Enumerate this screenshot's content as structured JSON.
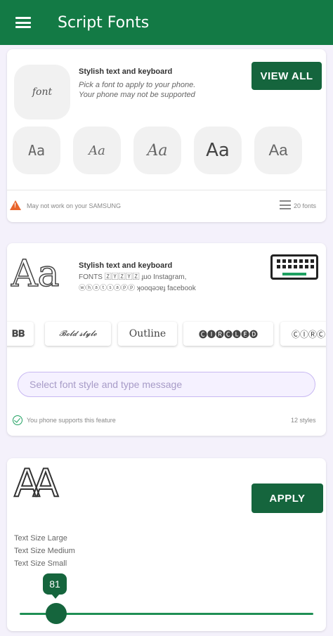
{
  "app": {
    "title": "Script Fonts"
  },
  "colors": {
    "primary": "#137a45",
    "button": "#15653d",
    "accent": "#1ea060",
    "warning": "#e8632b"
  },
  "card1": {
    "preview_text": "font",
    "heading": "Stylish text and keyboard",
    "subtitle_line1": "Pick a font to apply to your phone.",
    "subtitle_line2": "Your phone may not be supported",
    "button_label": "VIEW ALL",
    "font_tiles": [
      "Aa",
      "Aa",
      "Aa",
      "Aa",
      "Aa"
    ],
    "footer_warning": "May not work on your SAMSUNG",
    "footer_count": "20 fonts"
  },
  "card2": {
    "big_text": "Aa",
    "heading": "Stylish text and keyboard",
    "line1": "FONTS 🅉🅈🅉🅈🅉 ɟuo Instagram,",
    "line2": "ⓦⓗⓐⓣⓢⓐⓟⓟ ʞooqǝɔɐɟ facebook",
    "chips": [
      "𝐁𝐁",
      "𝓑𝓸𝓵𝓭 𝓼𝓽𝔂𝓵𝓮",
      "Outline",
      "🅒🅘🅡🅒🅛🅔🅓",
      "ⒸⒾⓇⒸ"
    ],
    "input_placeholder": "Select font style and type message",
    "support_text": "You phone supports this feature",
    "styles_count": "12 styles"
  },
  "card3": {
    "big_text": "AA",
    "button_label": "APPLY",
    "size_options": [
      "Text Size Large",
      "Text Size Medium",
      "Text Size Small"
    ],
    "slider_value": "81"
  }
}
